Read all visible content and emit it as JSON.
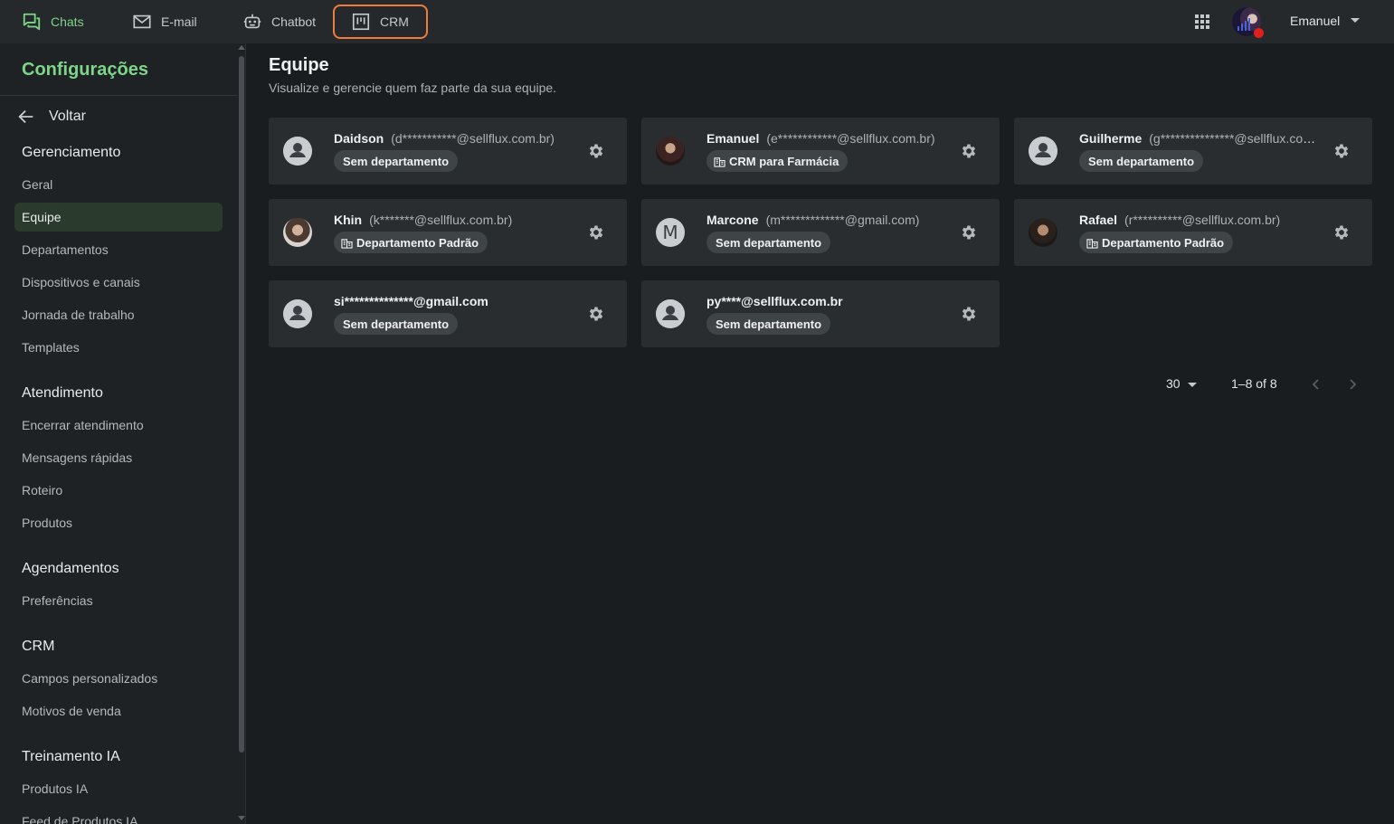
{
  "topnav": {
    "tabs": [
      {
        "label": "Chats",
        "icon": "chat-icon"
      },
      {
        "label": "E-mail",
        "icon": "mail-icon"
      },
      {
        "label": "Chatbot",
        "icon": "robot-icon"
      },
      {
        "label": "CRM",
        "icon": "kanban-icon"
      }
    ],
    "user_name": "Emanuel"
  },
  "sidebar": {
    "title": "Configurações",
    "back_label": "Voltar",
    "sections": [
      {
        "title": "Gerenciamento",
        "items": [
          "Geral",
          "Equipe",
          "Departamentos",
          "Dispositivos e canais",
          "Jornada de trabalho",
          "Templates"
        ]
      },
      {
        "title": "Atendimento",
        "items": [
          "Encerrar atendimento",
          "Mensagens rápidas",
          "Roteiro",
          "Produtos"
        ]
      },
      {
        "title": "Agendamentos",
        "items": [
          "Preferências"
        ]
      },
      {
        "title": "CRM",
        "items": [
          "Campos personalizados",
          "Motivos de venda"
        ]
      },
      {
        "title": "Treinamento IA",
        "items": [
          "Produtos IA",
          "Feed de Produtos IA"
        ]
      }
    ],
    "active_item": "Equipe"
  },
  "main": {
    "title": "Equipe",
    "subtitle": "Visualize e gerencie quem faz parte da sua equipe."
  },
  "members": [
    {
      "name": "Daidson",
      "email": "(d***********@sellflux.com.br)",
      "department": "Sem departamento",
      "dept_icon": false,
      "avatar": "person-icon"
    },
    {
      "name": "Emanuel",
      "email": "(e************@sellflux.com.br)",
      "department": "CRM para Farmácia",
      "dept_icon": true,
      "avatar": "photo"
    },
    {
      "name": "Guilherme",
      "email": "(g***************@sellflux.com.br)",
      "department": "Sem departamento",
      "dept_icon": false,
      "avatar": "person-icon"
    },
    {
      "name": "Khin",
      "email": "(k*******@sellflux.com.br)",
      "department": "Departamento Padrão",
      "dept_icon": true,
      "avatar": "photo"
    },
    {
      "name": "Marcone",
      "email": "(m*************@gmail.com)",
      "department": "Sem departamento",
      "dept_icon": false,
      "avatar": "M"
    },
    {
      "name": "Rafael",
      "email": "(r**********@sellflux.com.br)",
      "department": "Departamento Padrão",
      "dept_icon": true,
      "avatar": "photo"
    },
    {
      "name": "",
      "email": "si**************@gmail.com",
      "department": "Sem departamento",
      "dept_icon": false,
      "avatar": "person-icon"
    },
    {
      "name": "",
      "email": "py****@sellflux.com.br",
      "department": "Sem departamento",
      "dept_icon": false,
      "avatar": "person-icon"
    }
  ],
  "pagination": {
    "page_size": "30",
    "range": "1–8 of 8"
  },
  "colors": {
    "accent": "#7ed589",
    "highlight_border": "#f07b3f",
    "background": "#1a1d1f",
    "card": "#292d30",
    "status_dot": "#e0201b"
  }
}
